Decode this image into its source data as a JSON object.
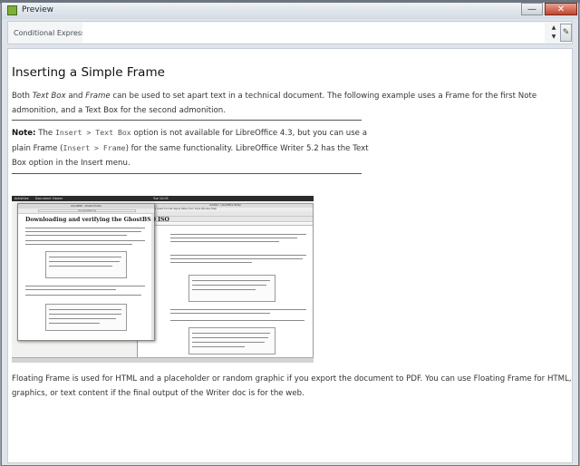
{
  "window": {
    "title": "Preview",
    "minimize_glyph": "—",
    "close_glyph": "✕"
  },
  "condition_bar": {
    "label": "Conditional Expression:",
    "value": "",
    "spin_up": "▲",
    "spin_down": "▼",
    "edit_icon": "pencil-icon",
    "edit_glyph": "✎"
  },
  "article": {
    "heading": "Inserting a Simple Frame",
    "intro": {
      "t1": "Both ",
      "i1": "Text Box",
      "t2": " and ",
      "i2": "Frame",
      "t3": " can be used to set apart text in a technical document. The following example uses a Frame for the first Note admonition, and a Text Box for the second admonition."
    },
    "note": {
      "label": "Note:",
      "t1": " The ",
      "code1": "Insert > Text Box",
      "t2": " option is not available for LibreOffice 4.3, but you can use a plain Frame (",
      "code2": "Insert > Frame",
      "t3": ") for the same functionality. LibreOffice Writer 5.2 has the Text Box option in the Insert menu."
    },
    "closing": "Floating Frame is used for HTML and a placeholder or random graphic if you export the document to PDF. You can use Floating Frame for HTML, graphics, or text content if the final output of the Writer doc is for the web."
  },
  "screenshot": {
    "taskbar_left": "Activities",
    "taskbar_app": "Document Viewer",
    "taskbar_clock": "Tue 10:05",
    "browser_title": "GhostBSD - Mozilla Firefox",
    "browser_url": "docs.ghostbsd.org",
    "browser_heading": "Downloading and verifying the GhostBSD ISO",
    "writer_title": "untitled - LibreOffice Writer",
    "writer_menu": "File  Edit  View  Insert  Format  Styles  Table  Form  Tools  Window  Help"
  },
  "colors": {
    "accent_green": "#7fae3a",
    "close_red": "#c0432c",
    "rule": "#555555"
  }
}
